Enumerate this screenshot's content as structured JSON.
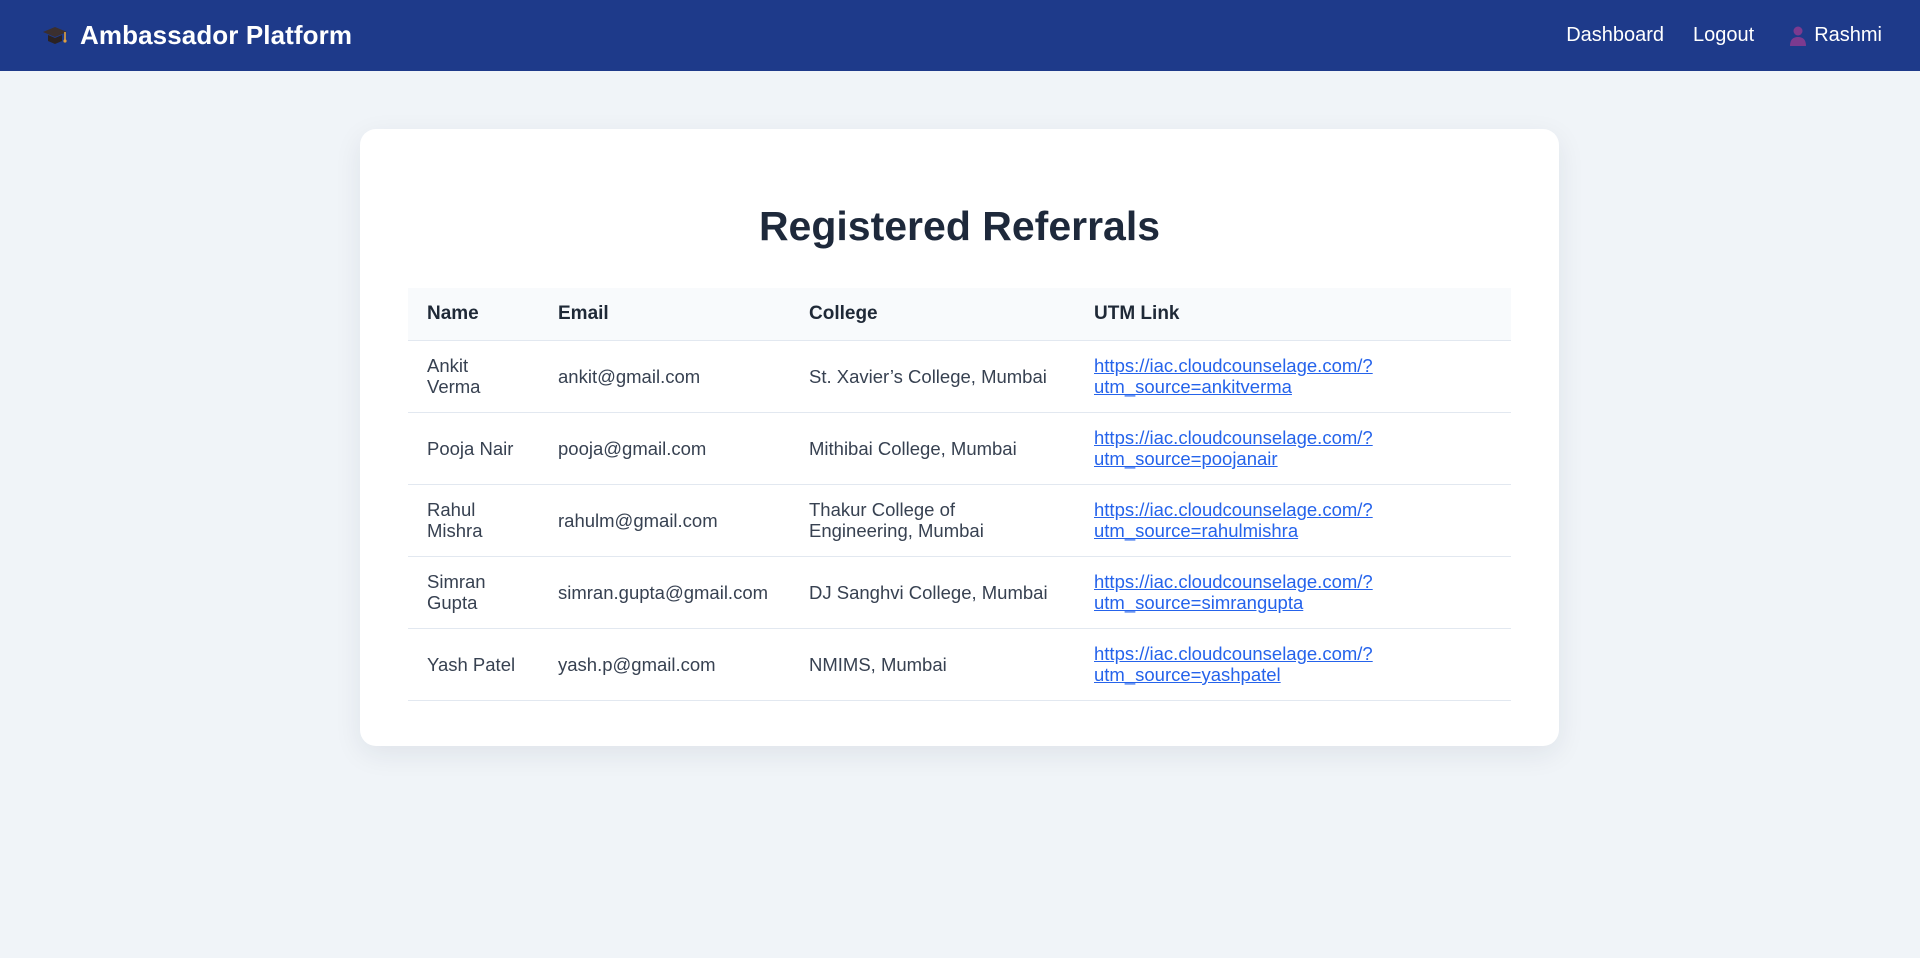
{
  "brand": {
    "title": "Ambassador Platform",
    "icon": "graduation-cap-icon"
  },
  "nav": {
    "dashboard_label": "Dashboard",
    "logout_label": "Logout",
    "user_name": "Rashmi",
    "user_icon": "person-icon"
  },
  "page": {
    "title": "Registered Referrals"
  },
  "table": {
    "headers": [
      "Name",
      "Email",
      "College",
      "UTM Link"
    ],
    "rows": [
      {
        "name": "Ankit Verma",
        "email": "ankit@gmail.com",
        "college": "St. Xavier’s College, Mumbai",
        "utm": "https://iac.cloudcounselage.com/?utm_source=ankitverma"
      },
      {
        "name": "Pooja Nair",
        "email": "pooja@gmail.com",
        "college": "Mithibai College, Mumbai",
        "utm": "https://iac.cloudcounselage.com/?utm_source=poojanair"
      },
      {
        "name": "Rahul Mishra",
        "email": "rahulm@gmail.com",
        "college": "Thakur College of Engineering, Mumbai",
        "utm": "https://iac.cloudcounselage.com/?utm_source=rahulmishra"
      },
      {
        "name": "Simran Gupta",
        "email": "simran.gupta@gmail.com",
        "college": "DJ Sanghvi College, Mumbai",
        "utm": "https://iac.cloudcounselage.com/?utm_source=simrangupta"
      },
      {
        "name": "Yash Patel",
        "email": "yash.p@gmail.com",
        "college": "NMIMS, Mumbai",
        "utm": "https://iac.cloudcounselage.com/?utm_source=yashpatel"
      }
    ]
  },
  "colors": {
    "navbar": "#1e3a8a",
    "background": "#f0f4f8",
    "link": "#2563eb"
  }
}
